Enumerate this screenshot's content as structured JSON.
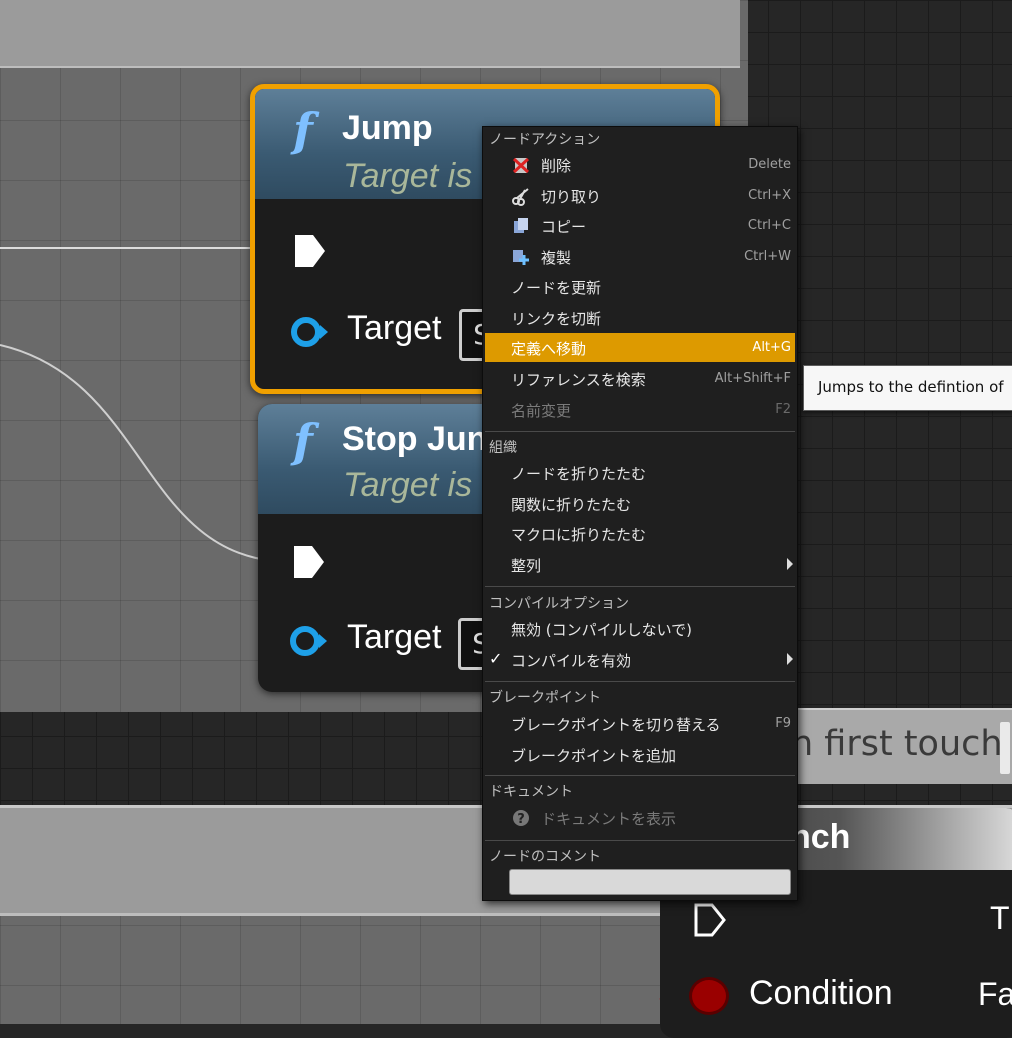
{
  "jump_node": {
    "title": "Jump",
    "subtitle": "Target is",
    "target_label": "Target",
    "target_value": "S"
  },
  "stop_node": {
    "title": "Stop Jun",
    "subtitle": "Target is",
    "target_label": "Target",
    "target_value": "S"
  },
  "comment_text": "n first touch",
  "branch_node": {
    "title": "nch",
    "out_true": "T",
    "out_false": "Fa",
    "condition_label": "Condition"
  },
  "context_menu": {
    "sections": {
      "node_actions": "ノードアクション",
      "organization": "組織",
      "compile_options": "コンパイルオプション",
      "breakpoints": "ブレークポイント",
      "documentation": "ドキュメント",
      "node_comment": "ノードのコメント"
    },
    "items": {
      "delete": {
        "label": "削除",
        "shortcut": "Delete",
        "icon": "delete-icon"
      },
      "cut": {
        "label": "切り取り",
        "shortcut": "Ctrl+X",
        "icon": "scissors-icon"
      },
      "copy": {
        "label": "コピー",
        "shortcut": "Ctrl+C",
        "icon": "copy-icon"
      },
      "duplicate": {
        "label": "複製",
        "shortcut": "Ctrl+W",
        "icon": "duplicate-icon"
      },
      "refresh": {
        "label": "ノードを更新"
      },
      "break_links": {
        "label": "リンクを切断"
      },
      "goto_definition": {
        "label": "定義へ移動",
        "shortcut": "Alt+G"
      },
      "find_refs": {
        "label": "リファレンスを検索",
        "shortcut": "Alt+Shift+F"
      },
      "rename": {
        "label": "名前変更",
        "shortcut": "F2"
      },
      "collapse_nodes": {
        "label": "ノードを折りたたむ"
      },
      "collapse_function": {
        "label": "関数に折りたたむ"
      },
      "collapse_macro": {
        "label": "マクロに折りたたむ"
      },
      "align": {
        "label": "整列"
      },
      "disable_compile": {
        "label": "無効 (コンパイルしないで)"
      },
      "enable_compile": {
        "label": "コンパイルを有効"
      },
      "toggle_breakpoint": {
        "label": "ブレークポイントを切り替える",
        "shortcut": "F9"
      },
      "add_breakpoint": {
        "label": "ブレークポイントを追加"
      },
      "view_docs": {
        "label": "ドキュメントを表示",
        "icon": "help-icon"
      }
    },
    "highlight_color": "#dd9a00"
  },
  "tooltip": {
    "text": "Jumps to the defintion of"
  },
  "colors": {
    "selection_outline": "#f0a000",
    "function_header": "#3a5a72",
    "object_pin": "#1ea0e8",
    "bool_pin": "#9a0000"
  }
}
